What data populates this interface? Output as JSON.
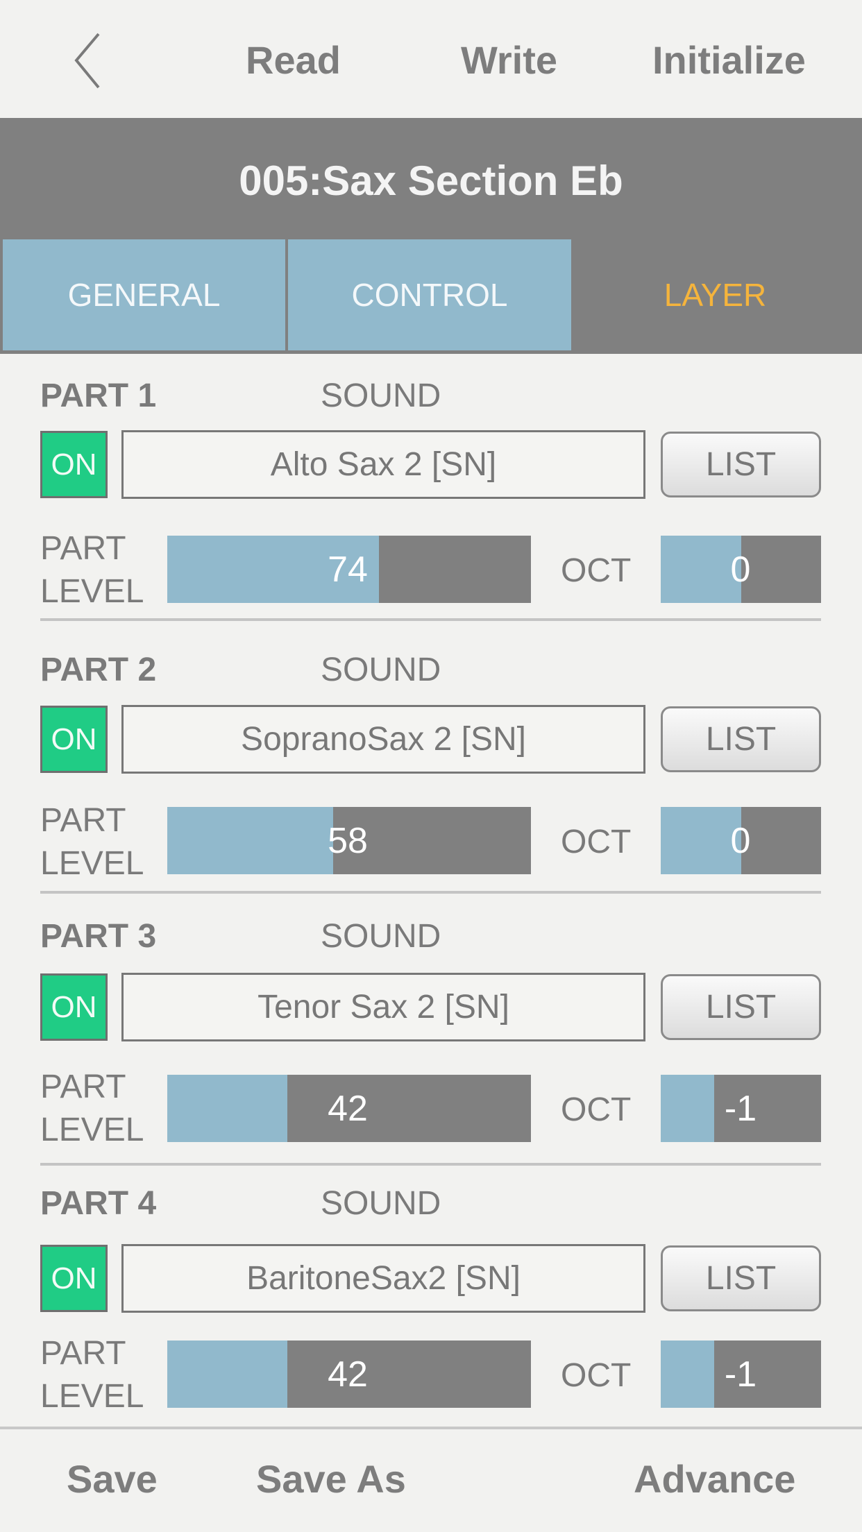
{
  "topbar": {
    "back_icon": "chevron-left-icon",
    "read_label": "Read",
    "write_label": "Write",
    "initialize_label": "Initialize"
  },
  "title": "005:Sax Section Eb",
  "tabs": [
    {
      "label": "GENERAL",
      "active": false
    },
    {
      "label": "CONTROL",
      "active": false
    },
    {
      "label": "LAYER",
      "active": true
    }
  ],
  "colors": {
    "tab_inactive_bg": "#91b9cc",
    "tab_active_text": "#f5b43c",
    "header_bg": "#808080",
    "on_green": "#20cc85",
    "bar_fill": "#91b9cc",
    "bar_track": "#808080"
  },
  "labels": {
    "sound": "SOUND",
    "on": "ON",
    "list": "LIST",
    "part_level_line1": "PART",
    "part_level_line2": "LEVEL",
    "oct": "OCT"
  },
  "parts": [
    {
      "title": "PART 1",
      "on": true,
      "sound": "Alto Sax 2 [SN]",
      "level": 74,
      "level_max": 127,
      "oct": 0,
      "oct_min": -3,
      "oct_max": 3
    },
    {
      "title": "PART 2",
      "on": true,
      "sound": "SopranoSax 2 [SN]",
      "level": 58,
      "level_max": 127,
      "oct": 0,
      "oct_min": -3,
      "oct_max": 3
    },
    {
      "title": "PART 3",
      "on": true,
      "sound": "Tenor Sax 2 [SN]",
      "level": 42,
      "level_max": 127,
      "oct": -1,
      "oct_min": -3,
      "oct_max": 3
    },
    {
      "title": "PART 4",
      "on": true,
      "sound": "BaritoneSax2 [SN]",
      "level": 42,
      "level_max": 127,
      "oct": -1,
      "oct_min": -3,
      "oct_max": 3
    }
  ],
  "bottombar": {
    "save_label": "Save",
    "save_as_label": "Save As",
    "advance_label": "Advance"
  }
}
